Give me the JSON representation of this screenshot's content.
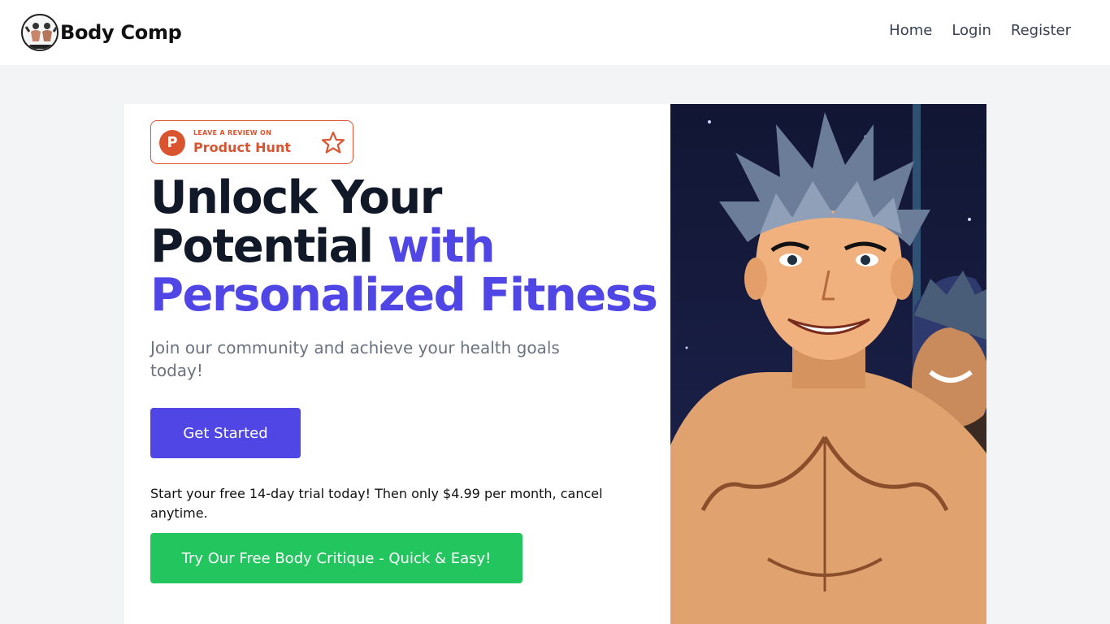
{
  "header": {
    "brand_name": "Body Comp",
    "logo_icon": "bodybuilders-logo-icon",
    "nav": {
      "home": "Home",
      "login": "Login",
      "register": "Register"
    }
  },
  "badge": {
    "small_text": "LEAVE A REVIEW ON",
    "big_text": "Product Hunt",
    "letter": "P",
    "icon": "star-outline-icon",
    "color": "#da552f"
  },
  "hero": {
    "headline_1": "Unlock Your",
    "headline_2": "Potential",
    "headline_accent_1": "with",
    "headline_accent_2": "Personalized Fitness",
    "subtitle": "Join our community and achieve your health goals today!",
    "cta_primary": "Get Started",
    "trial_text": "Start your free 14-day trial today! Then only $4.99 per month, cancel anytime.",
    "cta_secondary": "Try Our Free Body Critique - Quick & Easy!"
  },
  "colors": {
    "accent": "#4f46e5",
    "success": "#22c55e",
    "page_bg": "#f3f4f6"
  }
}
